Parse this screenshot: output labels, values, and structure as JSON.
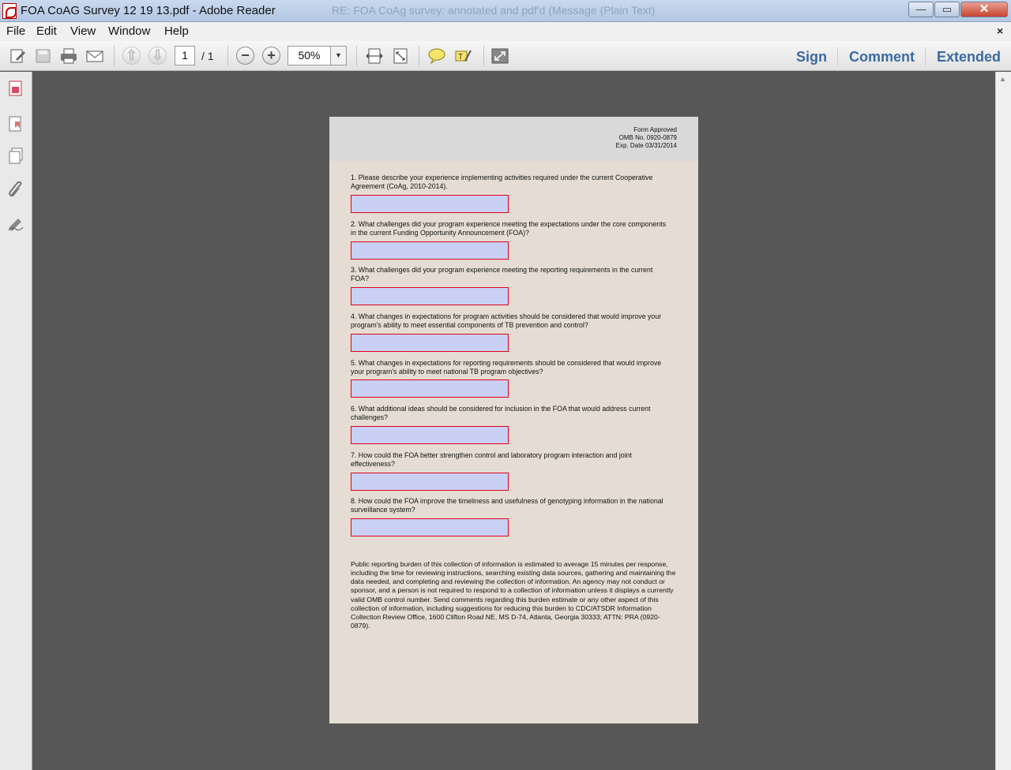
{
  "window": {
    "title": "FOA CoAG Survey 12 19 13.pdf - Adobe Reader",
    "background_window_title": "RE: FOA CoAg survey: annotated and pdf'd (Message (Plain Text)",
    "buttons": {
      "minimize": "—",
      "maximize": "▭",
      "close": "✕"
    }
  },
  "menu": {
    "items": [
      "File",
      "Edit",
      "View",
      "Window",
      "Help"
    ],
    "close_document": "×"
  },
  "toolbar": {
    "page_current": "1",
    "page_total": "/ 1",
    "zoom": "50%",
    "zoom_dropdown": "▼",
    "zoom_out": "−",
    "zoom_in": "+",
    "prev_page": "⇧",
    "next_page": "⇩",
    "right_buttons": [
      "Sign",
      "Comment",
      "Extended"
    ]
  },
  "document": {
    "header": {
      "line1": "Form Approved",
      "line2": "OMB No. 0920-0879",
      "line3": "Exp. Date 03/31/2014"
    },
    "questions": [
      {
        "text": "1. Please describe your experience implementing activities required under the current Cooperative Agreement (CoAg, 2010-2014).",
        "value": ""
      },
      {
        "text": "2. What challenges did your program experience meeting the expectations under the core components in the current Funding Opportunity Announcement (FOA)?",
        "value": ""
      },
      {
        "text": "3. What challenges did your program experience meeting the reporting requirements in the current FOA?",
        "value": ""
      },
      {
        "text": "4. What changes in expectations for program activities should be considered that would improve your program's ability to meet essential components of TB prevention and control?",
        "value": ""
      },
      {
        "text": "5. What changes in expectations for reporting requirements should be considered that would improve your program's ability to meet national TB program objectives?",
        "value": ""
      },
      {
        "text": "6. What additional ideas should be considered for inclusion in the FOA that would address current challenges?",
        "value": ""
      },
      {
        "text": "7. How could the FOA better strengthen control and laboratory program interaction and joint effectiveness?",
        "value": ""
      },
      {
        "text": "8. How could the FOA improve the timeliness and usefulness of genotyping information in the national surveillance system?",
        "value": ""
      }
    ],
    "burden_statement": "Public reporting burden of this collection of information is estimated to average 15 minutes per response, including the time for reviewing instructions, searching existing data sources, gathering and maintaining the data needed, and completing and reviewing the collection of information. An agency may not conduct or sponsor, and a person is not required to respond to a collection of information unless it displays a currently valid OMB control number.  Send comments regarding this burden estimate or any other aspect of this collection of information, including suggestions for reducing this burden to CDC/ATSDR Information Collection Review Office, 1600 Clifton Road NE, MS D-74,  Atlanta, Georgia 30333; ATTN:  PRA (0920-0879)."
  },
  "colors": {
    "field_fill": "#c9d0f4",
    "field_border": "#e0001b",
    "page_bg": "#e5ddd3",
    "workspace_bg": "#575757",
    "link_blue": "#3a6a9f"
  }
}
